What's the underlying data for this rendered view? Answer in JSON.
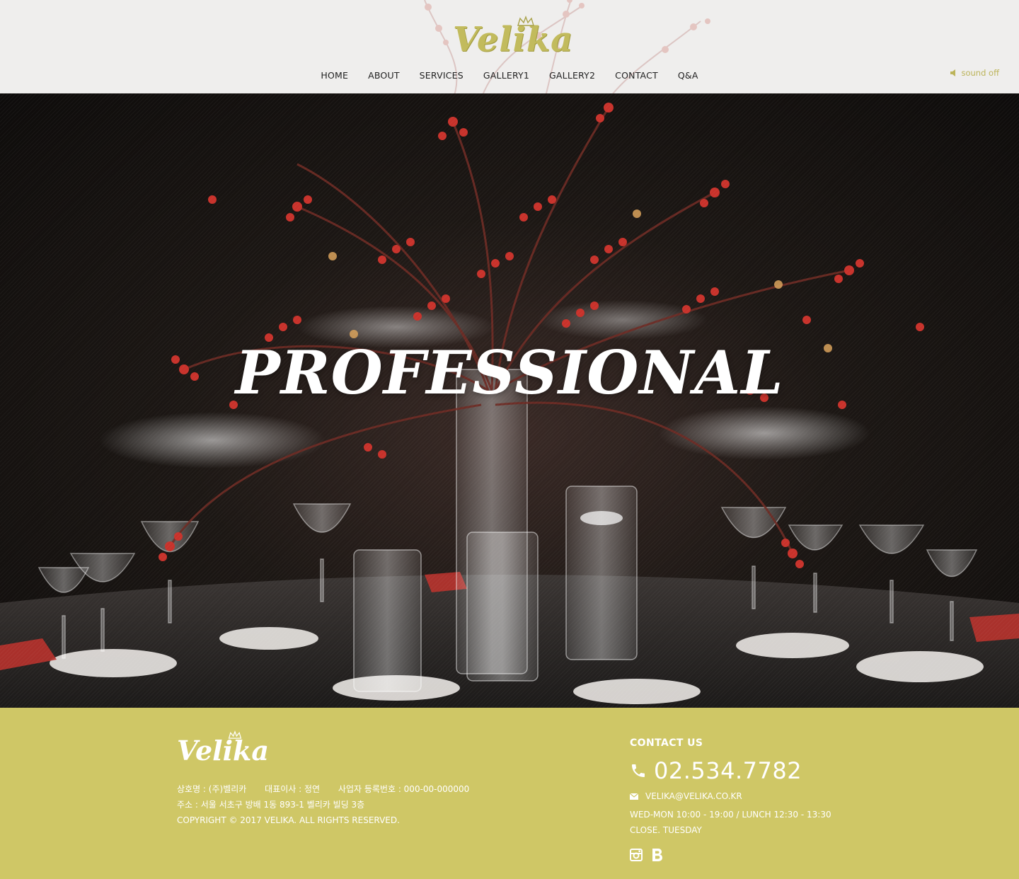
{
  "brand": {
    "name": "Velika"
  },
  "nav": {
    "items": [
      "HOME",
      "ABOUT",
      "SERVICES",
      "GALLERY1",
      "GALLERY2",
      "CONTACT",
      "Q&A"
    ]
  },
  "sound": {
    "label": "sound off",
    "icon": "speaker-icon"
  },
  "hero": {
    "title": "PROFESSIONAL"
  },
  "footer": {
    "company_label": "상호명 : (주)벨리카",
    "ceo_label": "대표이사 : 정연",
    "biz_label": "사업자 등록번호 : 000-00-000000",
    "address": "주소 : 서울 서초구 방배 1동 893-1 벨리카 빌딩 3층",
    "copyright": "COPYRIGHT © 2017 VELIKA. ALL RIGHTS RESERVED."
  },
  "contact": {
    "title": "CONTACT US",
    "phone": "02.534.7782",
    "email": "VELIKA@VELIKA.CO.KR",
    "hours": "WED-MON 10:00 - 19:00 / LUNCH 12:30 - 13:30",
    "closed": "CLOSE. TUESDAY",
    "social": [
      "instagram-icon",
      "blog-icon"
    ]
  },
  "colors": {
    "accent": "#cfc766",
    "logo_gold": "#c2bb5d",
    "header_bg": "#efeeed"
  }
}
